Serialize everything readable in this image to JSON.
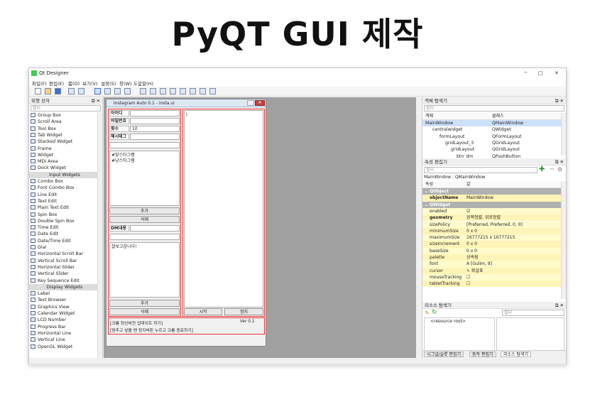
{
  "banner": {
    "title": "PyQT GUI 제작"
  },
  "app": {
    "title": "Qt Designer",
    "minimize": "–",
    "maximize": "□",
    "close": "✕"
  },
  "menu": [
    "파일(F)",
    "편집(E)",
    "폼(O)",
    "보기(V)",
    "설정(S)",
    "창(W)",
    "도움말(H)"
  ],
  "widget_box": {
    "title": "위젯 상자",
    "filter_placeholder": "필터",
    "items_top": [
      "Group Box",
      "Scroll Area",
      "Tool Box",
      "Tab Widget",
      "Stacked Widget",
      "Frame",
      "Widget",
      "MDI Area",
      "Dock Widget"
    ],
    "cat_input": "Input Widgets",
    "items_input": [
      "Combo Box",
      "Font Combo Box",
      "Line Edit",
      "Text Edit",
      "Plain Text Edit",
      "Spin Box",
      "Double Spin Box",
      "Time Edit",
      "Date Edit",
      "Date/Time Edit",
      "Dial",
      "Horizontal Scroll Bar",
      "Vertical Scroll Bar",
      "Horizontal Slider",
      "Vertical Slider",
      "Key Sequence Edit"
    ],
    "cat_display": "Display Widgets",
    "items_display": [
      "Label",
      "Text Browser",
      "Graphics View",
      "Calendar Widget",
      "LCD Number",
      "Progress Bar",
      "Horizontal Line",
      "Vertical Line",
      "OpenGL Widget"
    ]
  },
  "form": {
    "title": "Instagram Auto 0.1 - insta.ui",
    "id_label": "아이디",
    "pw_label": "비밀번호",
    "count_label": "횟수",
    "count_value": "10",
    "hashtag_label": "해시태그",
    "hashtag_list": "#맞스타그램\n#냥스타그램",
    "add1": "추가",
    "del1": "삭제",
    "dm_label": "DM내용",
    "dm_text": "잘보고갑니다!",
    "add2": "추가",
    "del2": "삭제",
    "start": "시작",
    "stop": "정지",
    "note1": "[크롬 최신버전 업데이트 하기]",
    "version": "Ver 0.1",
    "note2": "[멈추고 싶을 땐 정지버튼 누르고 크롬 종료하기]",
    "side_text": "|"
  },
  "object_inspector": {
    "title": "객체 탐색기",
    "filter_placeholder": "필터",
    "col_object": "객체",
    "col_class": "클래스",
    "rows": [
      {
        "name": "MainWindow",
        "cls": "QMainWindow"
      },
      {
        "name": "centralwidget",
        "cls": "QWidget"
      },
      {
        "name": "formLayout",
        "cls": "QFormLayout"
      },
      {
        "name": "gridLayout_3",
        "cls": "QGridLayout"
      },
      {
        "name": "gridLayout",
        "cls": "QGridLayout"
      },
      {
        "name": "btn_dm",
        "cls": "QPushButton"
      }
    ]
  },
  "property_editor": {
    "title": "속성 편집기",
    "filter_placeholder": "필터",
    "context": "MainWindow : QMainWindow",
    "col_prop": "속성",
    "col_value": "값",
    "sec_qobject": "QObject",
    "sec_qwidget": "QWidget",
    "props": [
      {
        "n": "objectName",
        "v": "MainWindow",
        "bold": true
      },
      {
        "n": "enabled",
        "v": "☑",
        "bold": false
      },
      {
        "n": "geometry",
        "v": "왼쪽정렬, 위로정렬",
        "bold": true
      },
      {
        "n": "sizePolicy",
        "v": "[Preferred, Preferred, 0, 0]",
        "bold": false
      },
      {
        "n": "minimumSize",
        "v": "0 x 0",
        "bold": false
      },
      {
        "n": "maximumSize",
        "v": "16777215 x 16777215",
        "bold": false
      },
      {
        "n": "sizeIncrement",
        "v": "0 x 0",
        "bold": false
      },
      {
        "n": "baseSize",
        "v": "0 x 0",
        "bold": false
      },
      {
        "n": "palette",
        "v": "상속됨",
        "bold": false
      },
      {
        "n": "font",
        "v": "A [Gulim, 9]",
        "bold": false
      },
      {
        "n": "cursor",
        "v": "↖ 화살표",
        "bold": false
      },
      {
        "n": "mouseTracking",
        "v": "☐",
        "bold": false
      },
      {
        "n": "tabletTracking",
        "v": "☐",
        "bold": false
      }
    ]
  },
  "resource_browser": {
    "title": "리소스 탐색기",
    "filter_placeholder": "필터",
    "root": "<resource root>",
    "tabs": [
      "시그널/슬롯 편집기",
      "동작 편집기",
      "리소스 탐색기"
    ]
  },
  "colors": {
    "accent": "#3a6fd8",
    "form_red": "#e33333",
    "prop_yellow": "#fffbcc",
    "prop_section": "#b0b0b0"
  }
}
